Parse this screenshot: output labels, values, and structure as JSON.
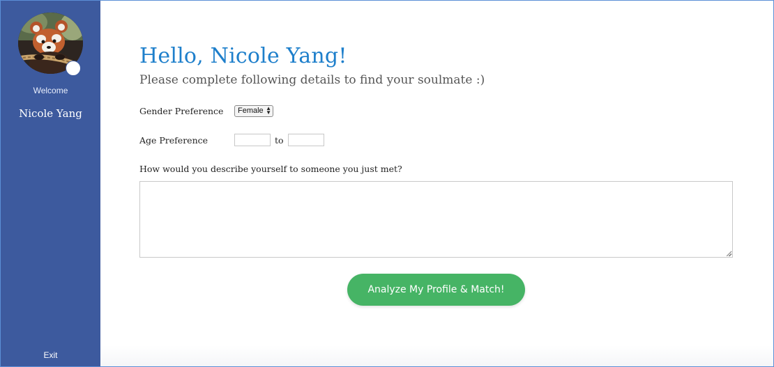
{
  "sidebar": {
    "avatar_icon": "red-panda-avatar",
    "status_icon": "status-dot-icon",
    "welcome_text": "Welcome",
    "user_name": "Nicole Yang",
    "exit_label": "Exit",
    "background_color": "#3d5a9e"
  },
  "main": {
    "greeting": "Hello, Nicole Yang!",
    "subtitle": "Please complete following details to find your soulmate :)",
    "gender": {
      "label": "Gender Preference",
      "selected": "Female"
    },
    "age": {
      "label": "Age Preference",
      "from_value": "",
      "to_value": "",
      "separator": "to"
    },
    "describe": {
      "label": "How would you describe yourself to someone you just met?",
      "value": ""
    },
    "analyze_button_label": "Analyze My Profile & Match!",
    "accent_color": "#1e7fcb",
    "button_color": "#46b465"
  }
}
